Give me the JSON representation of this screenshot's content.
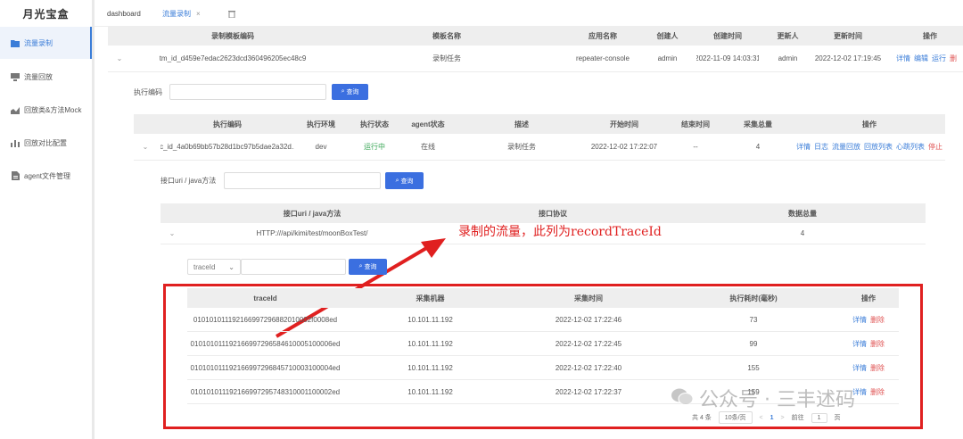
{
  "app": {
    "logo": "月光宝盒"
  },
  "sidebar": {
    "items": [
      {
        "label": "流量录制",
        "icon": "folder-icon"
      },
      {
        "label": "流量回放",
        "icon": "monitor-icon"
      },
      {
        "label": "回放类&方法Mock",
        "icon": "chart-icon"
      },
      {
        "label": "回放对比配置",
        "icon": "bar-chart-icon"
      },
      {
        "label": "agent文件管理",
        "icon": "file-icon"
      }
    ]
  },
  "tabs": [
    {
      "label": "dashboard"
    },
    {
      "label": "流量录制",
      "close": "×"
    }
  ],
  "template_table": {
    "headers": [
      "录制模板编码",
      "模板名称",
      "应用名称",
      "创建人",
      "创建时间",
      "更新人",
      "更新时间",
      "操作"
    ],
    "row": {
      "code": "tm_id_d459e7edac2623dcd360496205ec48c9",
      "name": "录制任务",
      "app": "repeater-console",
      "creator": "admin",
      "created": "2022-11-09 14:03:31",
      "updater": "admin",
      "updated": "2022-12-02 17:19:45",
      "actions": [
        "详情",
        "编辑",
        "运行",
        "删"
      ]
    }
  },
  "exec_search": {
    "label": "执行编码",
    "button": "查询"
  },
  "exec_table": {
    "headers": [
      "执行编码",
      "执行环境",
      "执行状态",
      "agent状态",
      "描述",
      "开始时间",
      "结束时间",
      "采集总量",
      "操作"
    ],
    "row": {
      "code": "rc_id_4a0b69bb57b28d1bc97b5dae2a32d...",
      "env": "dev",
      "status": "运行中",
      "agent": "在线",
      "desc": "录制任务",
      "start": "2022-12-02 17:22:07",
      "end": "--",
      "total": "4",
      "actions": [
        "详情",
        "日志",
        "流量回放",
        "回放列表",
        "心跳列表",
        "停止"
      ]
    }
  },
  "uri_search": {
    "label": "接口uri / java方法",
    "button": "查询"
  },
  "uri_table": {
    "headers": [
      "接口uri / java方法",
      "接口协议",
      "数据总量"
    ],
    "row": {
      "uri": "HTTP:///api/kimi/test/moonBoxTest/",
      "protocol": "",
      "total": "4"
    }
  },
  "annotation": {
    "text": "录制的流量，此列为recordTraceId",
    "color": "#e02020"
  },
  "trace_search": {
    "select": "traceId",
    "button": "查询"
  },
  "trace_table": {
    "headers": [
      "traceId",
      "采集机器",
      "采集时间",
      "执行耗时(毫秒)",
      "操作"
    ],
    "rows": [
      {
        "traceId": "010101011192166997296882010002f0008ed",
        "host": "10.101.11.192",
        "time": "2022-12-02 17:22:46",
        "cost": "73"
      },
      {
        "traceId": "010101011192166997296584610005100006ed",
        "host": "10.101.11.192",
        "time": "2022-12-02 17:22:45",
        "cost": "99"
      },
      {
        "traceId": "010101011192166997296845710003100004ed",
        "host": "10.101.11.192",
        "time": "2022-12-02 17:22:40",
        "cost": "155"
      },
      {
        "traceId": "010101011192166997295748310001100002ed",
        "host": "10.101.11.192",
        "time": "2022-12-02 17:22:37",
        "cost": "159"
      }
    ],
    "row_actions": [
      "详情",
      "删除"
    ]
  },
  "pagination": {
    "total": "共 4 条",
    "page_size": "10条/页",
    "prev": "<",
    "current": "1",
    "next": ">",
    "goto": "前往",
    "goto_value": "1",
    "page_unit": "页"
  },
  "watermark": {
    "text": "公众号 · 三丰述码"
  },
  "colors": {
    "accent": "#3b7dd8",
    "danger": "#e05656",
    "highlight_box": "#e02020",
    "running": "#3aa757"
  }
}
